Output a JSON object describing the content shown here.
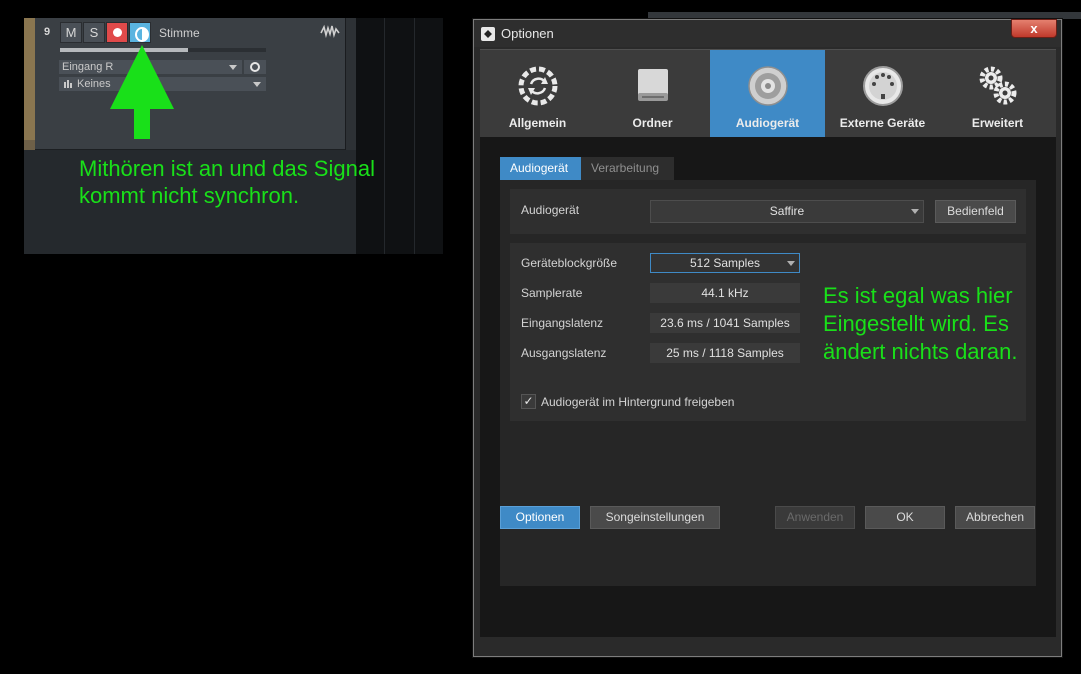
{
  "track": {
    "number": "9",
    "mute_label": "M",
    "solo_label": "S",
    "name": "Stimme",
    "volume_level": 0.62,
    "input": "Eingang R",
    "output": "Keines"
  },
  "annotations": {
    "left_text": "Mithören ist an und das Signal kommt nicht synchron.",
    "right_text": "Es ist egal was hier Eingestellt wird. Es ändert nichts daran."
  },
  "dialog": {
    "title": "Optionen",
    "close_label": "x",
    "tabs": [
      {
        "label": "Allgemein",
        "icon": "sync-icon"
      },
      {
        "label": "Ordner",
        "icon": "drive-icon"
      },
      {
        "label": "Audiogerät",
        "icon": "speaker-icon"
      },
      {
        "label": "Externe Geräte",
        "icon": "midi-port-icon"
      },
      {
        "label": "Erweitert",
        "icon": "gears-icon"
      }
    ],
    "subtabs": [
      "Audiogerät",
      "Verarbeitung"
    ],
    "device": {
      "label": "Audiogerät",
      "value": "Saffire",
      "control_panel_label": "Bedienfeld"
    },
    "settings": {
      "blocksize_label": "Geräteblockgröße",
      "blocksize_value": "512 Samples",
      "samplerate_label": "Samplerate",
      "samplerate_value": "44.1 kHz",
      "input_latency_label": "Eingangslatenz",
      "input_latency_value": "23.6 ms / 1041 Samples",
      "output_latency_label": "Ausgangslatenz",
      "output_latency_value": "25 ms / 1118 Samples",
      "background_checkbox_label": "Audiogerät im Hintergrund freigeben",
      "background_checked": true
    },
    "footer": {
      "options": "Optionen",
      "song_settings": "Songeinstellungen",
      "apply": "Anwenden",
      "ok": "OK",
      "cancel": "Abbrechen"
    }
  },
  "colors": {
    "accent": "#3f8ac6",
    "annotation": "#19e019",
    "record": "#e04a4a",
    "monitor": "#5ab4e0"
  }
}
